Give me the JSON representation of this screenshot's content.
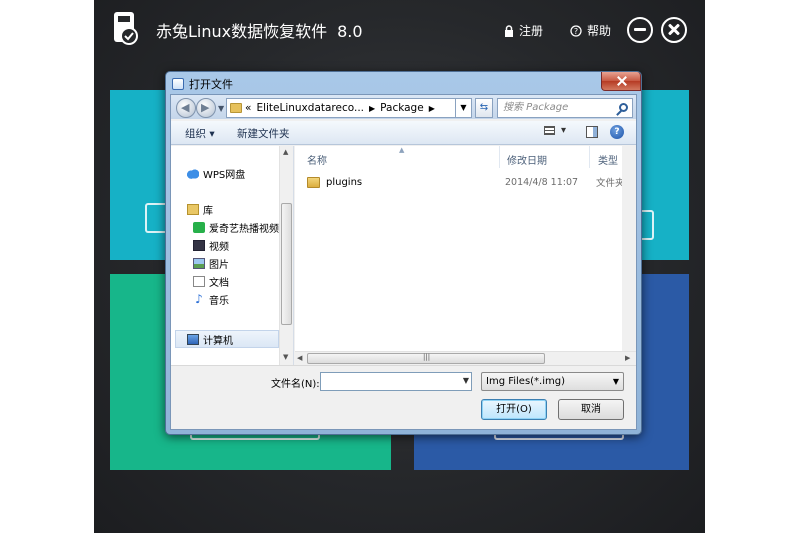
{
  "app": {
    "title": "赤兔Linux数据恢复软件",
    "version": "8.0",
    "register_label": "注册",
    "help_label": "帮助"
  },
  "dialog": {
    "title": "打开文件",
    "address": {
      "prefix": "«",
      "segments": [
        "EliteLinuxdatareco...",
        "Package"
      ]
    },
    "search_placeholder": "搜索 Package",
    "toolbar": {
      "organize_label": "组织 ▾",
      "newfolder_label": "新建文件夹"
    },
    "nav": {
      "items": [
        {
          "label": "WPS网盘",
          "icon": "cloud-icon"
        },
        {
          "label": "库",
          "icon": "library-icon"
        },
        {
          "label": "爱奇艺热播视频",
          "icon": "iqiyi-icon"
        },
        {
          "label": "视频",
          "icon": "video-icon"
        },
        {
          "label": "图片",
          "icon": "picture-icon"
        },
        {
          "label": "文档",
          "icon": "document-icon"
        },
        {
          "label": "音乐",
          "icon": "music-icon"
        },
        {
          "label": "计算机",
          "icon": "computer-icon"
        }
      ]
    },
    "columns": {
      "name": "名称",
      "date": "修改日期",
      "type": "类型"
    },
    "files": [
      {
        "name": "plugins",
        "date": "2014/4/8 11:07",
        "type": "文件夹"
      }
    ],
    "filename_label": "文件名(N):",
    "filename_value": "",
    "filetype_selected": "Img Files(*.img)",
    "open_label": "打开(O)",
    "cancel_label": "取消"
  }
}
